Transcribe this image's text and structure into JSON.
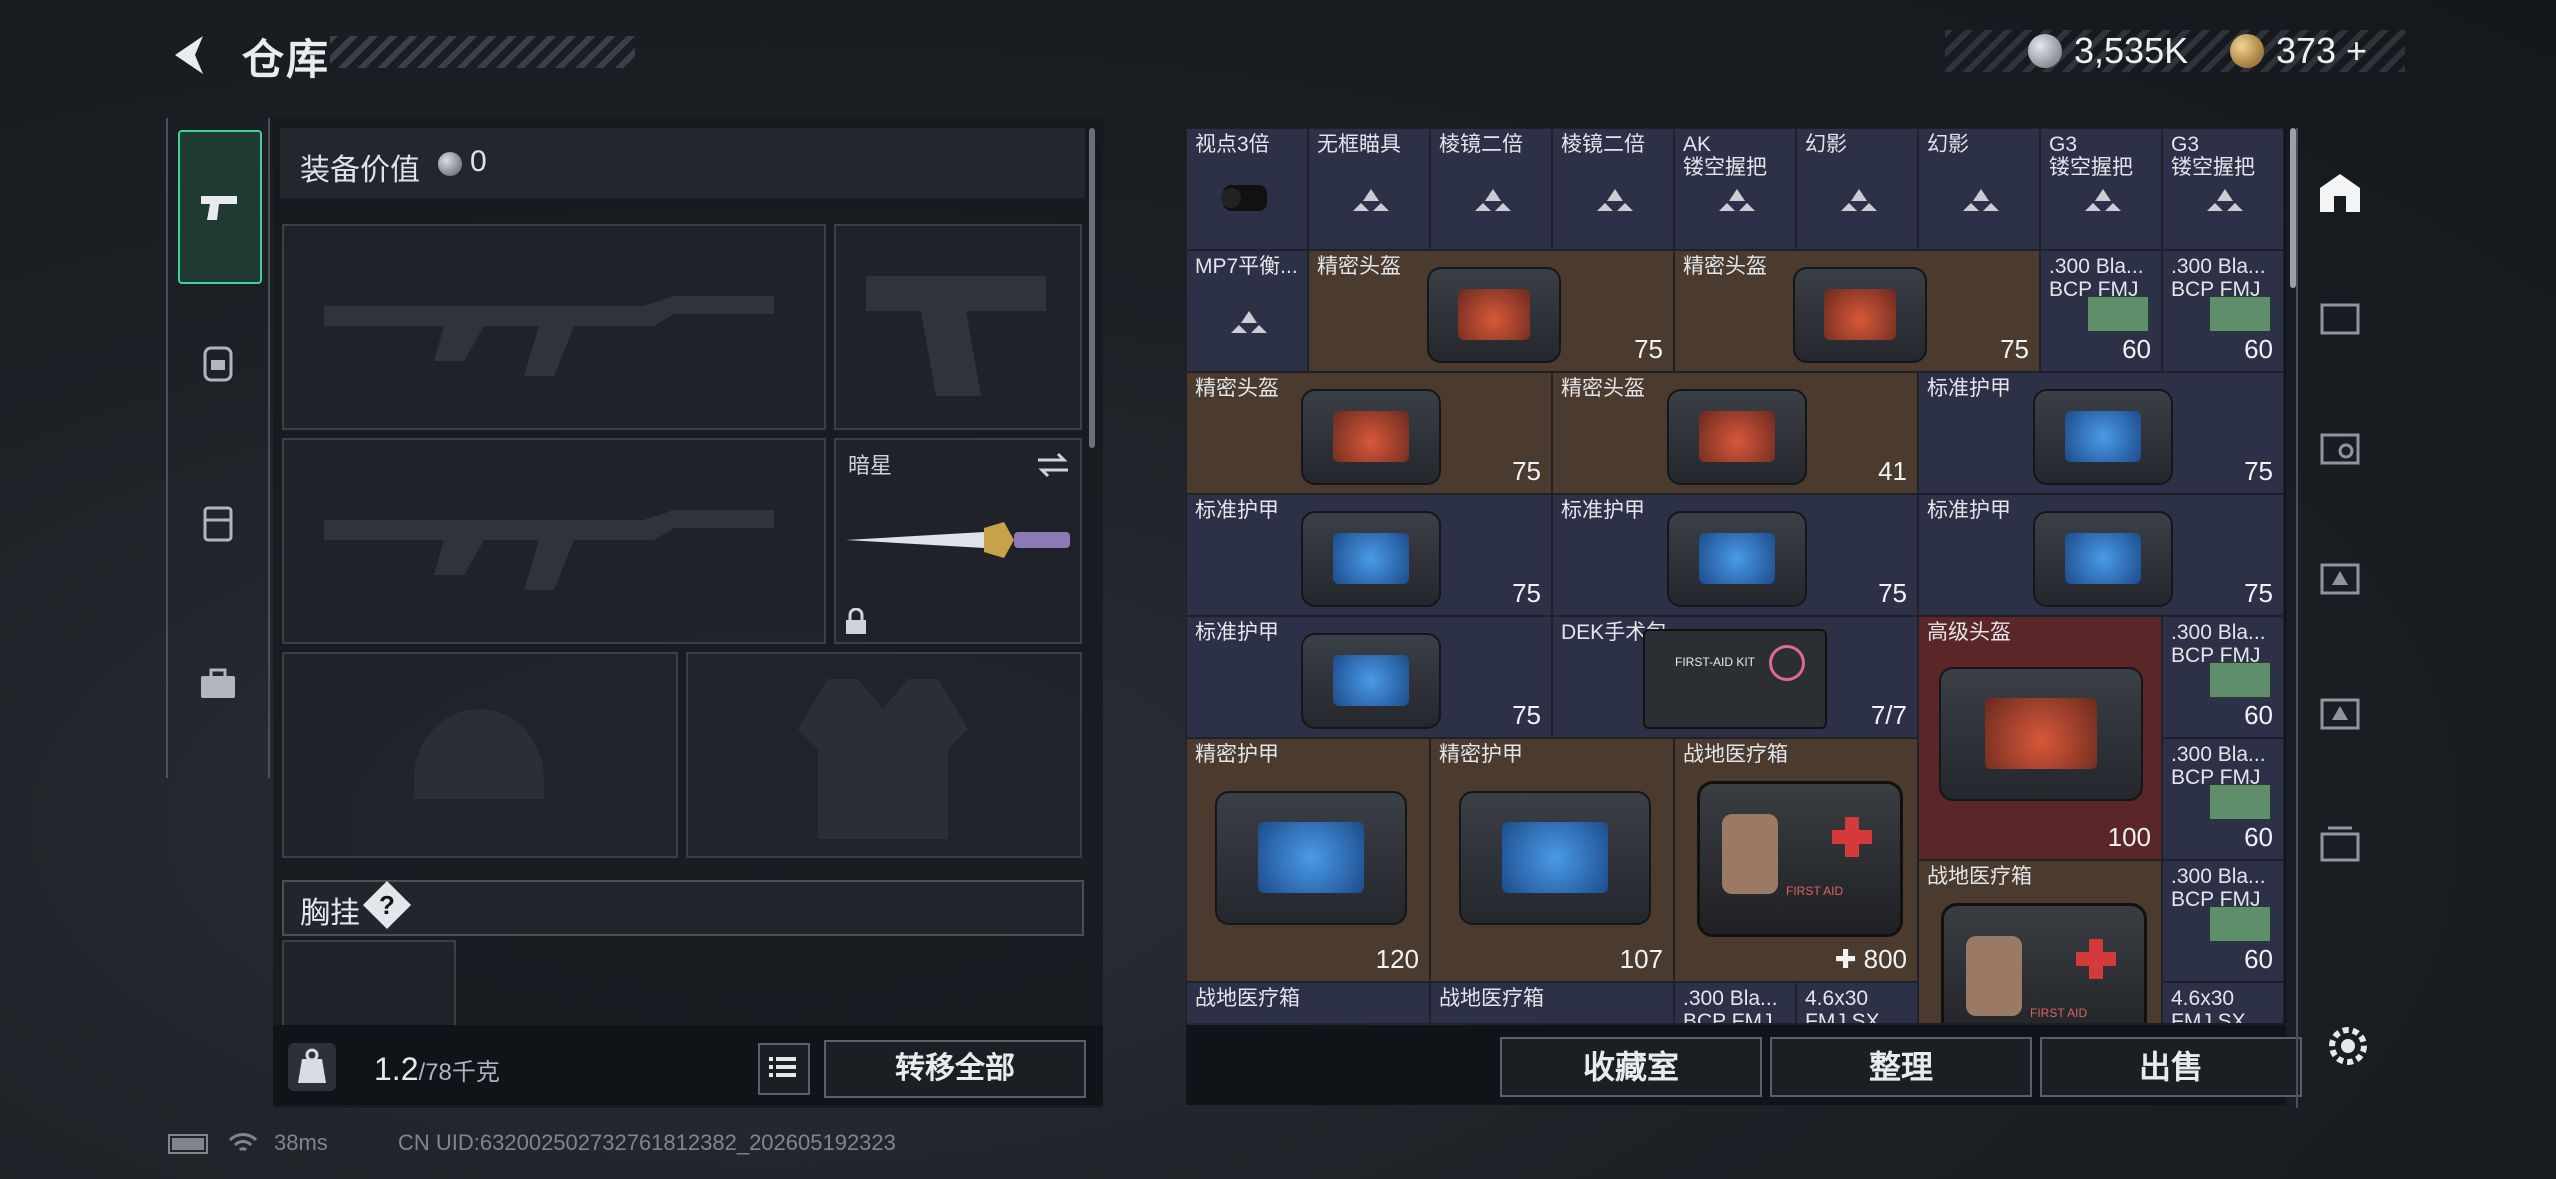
{
  "header": {
    "title": "仓库",
    "silver_amount": "3,535K",
    "gold_amount": "373",
    "gold_add": "+"
  },
  "equipment": {
    "value_label": "装备价值",
    "value": "0",
    "melee_slot_label": "暗星",
    "chest_label": "胸挂",
    "chest_help": "?",
    "weight_current": "1.2",
    "weight_max": "/78千克",
    "transfer_all": "转移全部"
  },
  "grid": {
    "cells": [
      {
        "label": "视点3倍",
        "line2": ""
      },
      {
        "label": "无框瞄具",
        "line2": ""
      },
      {
        "label": "棱镜二倍",
        "line2": ""
      },
      {
        "label": "棱镜二倍",
        "line2": ""
      },
      {
        "label": "AK",
        "line2": "镂空握把"
      },
      {
        "label": "幻影",
        "line2": ""
      },
      {
        "label": "幻影",
        "line2": ""
      },
      {
        "label": "G3",
        "line2": "镂空握把"
      },
      {
        "label": "G3",
        "line2": "镂空握把"
      },
      {
        "label": "MP7平衡...",
        "line2": ""
      },
      {
        "label": "精密头盔",
        "durability": "75"
      },
      {
        "label": "精密头盔",
        "durability": "75"
      },
      {
        "label": ".300 Bla...",
        "line2": "BCP FMJ",
        "count": "60"
      },
      {
        "label": ".300 Bla...",
        "line2": "BCP FMJ",
        "count": "60"
      },
      {
        "label": "精密头盔",
        "durability": "75"
      },
      {
        "label": "精密头盔",
        "durability": "41"
      },
      {
        "label": "标准护甲",
        "durability": "75"
      },
      {
        "label": "标准护甲",
        "durability": "75"
      },
      {
        "label": "标准护甲",
        "durability": "75"
      },
      {
        "label": "标准护甲",
        "durability": "75"
      },
      {
        "label": "标准护甲",
        "durability": "75"
      },
      {
        "label": "DEK手术包",
        "count": "7/7",
        "kit_text": "FIRST-AID KIT"
      },
      {
        "label": "高级头盔",
        "durability": "100"
      },
      {
        "label": ".300 Bla...",
        "line2": "BCP FMJ",
        "count": "60"
      },
      {
        "label": ".300 Bla...",
        "line2": "BCP FMJ",
        "count": "60"
      },
      {
        "label": "精密护甲",
        "durability": "120"
      },
      {
        "label": "精密护甲",
        "durability": "107"
      },
      {
        "label": "战地医疗箱",
        "heal": "800",
        "first_aid_text": "FIRST AID"
      },
      {
        "label": "战地医疗箱",
        "first_aid_text": "FIRST AID"
      },
      {
        "label": ".300 Bla...",
        "line2": "BCP FMJ",
        "count": "60"
      },
      {
        "label": "战地医疗箱"
      },
      {
        "label": "战地医疗箱"
      },
      {
        "label": ".300 Bla...",
        "line2": "BCP FMJ"
      },
      {
        "label": "4.6x30",
        "line2": "FMJ SX"
      },
      {
        "label": "4.6x30",
        "line2": "FMJ SX"
      }
    ]
  },
  "actions": {
    "collection": "收藏室",
    "organize": "整理",
    "sell": "出售"
  },
  "status": {
    "ping": "38ms",
    "uid": "CN UID:632002502732761812382_202605192323"
  },
  "colors": {
    "accent_green": "#3fd0a0",
    "cell_blue": "#2d3148",
    "cell_brown": "#4a3b2e",
    "cell_red": "#5a2628"
  }
}
